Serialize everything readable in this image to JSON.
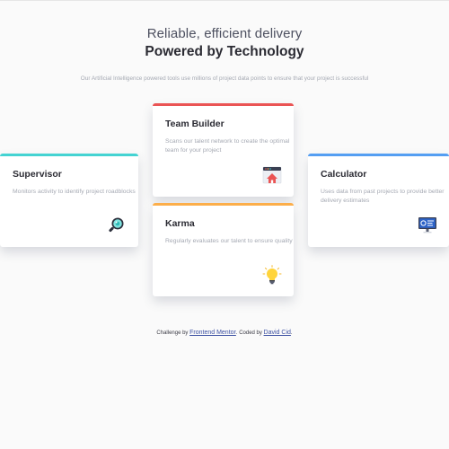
{
  "header": {
    "subtitle": "Reliable, efficient delivery",
    "title": "Powered by Technology",
    "intro": "Our Artificial Intelligence powered tools use millions of project data points to ensure that your project is successful"
  },
  "cards": {
    "supervisor": {
      "title": "Supervisor",
      "description": "Monitors activity to identify project roadblocks",
      "accent": "#44d3d2",
      "icon": "magnifier-icon"
    },
    "team_builder": {
      "title": "Team Builder",
      "description": "Scans our talent network to create the optimal team for your project",
      "accent": "#ea5454",
      "icon": "team-builder-icon"
    },
    "karma": {
      "title": "Karma",
      "description": "Regularly evaluates our talent to ensure quality",
      "accent": "#fcae4a",
      "icon": "lightbulb-icon"
    },
    "calculator": {
      "title": "Calculator",
      "description": "Uses data from past projects to provide better delivery estimates",
      "accent": "#549ef2",
      "icon": "monitor-icon"
    }
  },
  "attribution": {
    "prefix": "Challenge by ",
    "challenge_link": "Frontend Mentor",
    "middle": ". Coded by ",
    "author_link": "David Cid",
    "suffix": "."
  }
}
